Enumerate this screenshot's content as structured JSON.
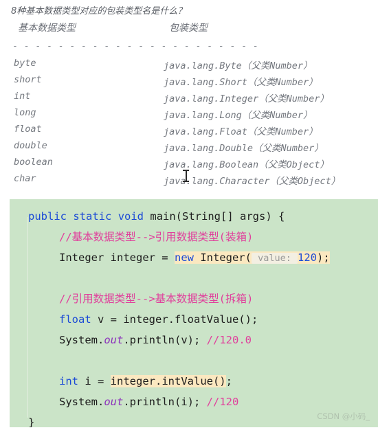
{
  "notes": {
    "title": "8种基本数据类型对应的包装类型名是什么？",
    "header_primitive": "基本数据类型",
    "header_wrapper": "包装类型",
    "divider": "- - - - - - - - - - - - - - - - - - - - - - - - - - - - - - - - - -",
    "rows": [
      {
        "primitive": "byte",
        "wrapper": "java.lang.Byte（父类Number）"
      },
      {
        "primitive": "short",
        "wrapper": "java.lang.Short（父类Number）"
      },
      {
        "primitive": "int",
        "wrapper": "java.lang.Integer（父类Number）"
      },
      {
        "primitive": "long",
        "wrapper": "java.lang.Long（父类Number）"
      },
      {
        "primitive": "float",
        "wrapper": "java.lang.Float（父类Number）"
      },
      {
        "primitive": "double",
        "wrapper": "java.lang.Double（父类Number）"
      },
      {
        "primitive": "boolean",
        "wrapper": "java.lang.Boolean（父类Object）"
      },
      {
        "primitive": "char",
        "wrapper": "java.lang.Character（父类Object）"
      }
    ]
  },
  "code": {
    "line1": {
      "kw_public": "public",
      "sp1": " ",
      "kw_static": "static",
      "sp2": " ",
      "kw_void": "void",
      "sp3": " ",
      "signature": "main(String[] args) {"
    },
    "line2_comment": "//基本数据类型-->引用数据类型(装箱)",
    "line3": {
      "decl": "Integer integer = ",
      "kw_new": "new",
      "call_open": " Integer(",
      "param_hint": " value: ",
      "value": "120",
      "call_close": ");"
    },
    "line5_comment": "//引用数据类型-->基本数据类型(拆箱)",
    "line6": {
      "kw_float": "float",
      "rest": " v = integer.floatValue();"
    },
    "line7": {
      "sys": "System.",
      "out": "out",
      "call": ".println(v); ",
      "comment": "//120.0"
    },
    "line9": {
      "kw_int": "int",
      "assign": " i = ",
      "highlighted": "integer.intValue()",
      "semi": ";"
    },
    "line10": {
      "sys": "System.",
      "out": "out",
      "call": ".println(i); ",
      "comment": "//120"
    },
    "line11_close": "}"
  },
  "watermark": "CSDN @小码_",
  "colors": {
    "code_background": "#cbe4c8",
    "keyword": "#1b4ad6",
    "comment": "#e0409c",
    "field_italic": "#8b2fbb",
    "highlight": "#fbe8c0",
    "note_text": "#74787f",
    "watermark": "#b0c2ae"
  }
}
